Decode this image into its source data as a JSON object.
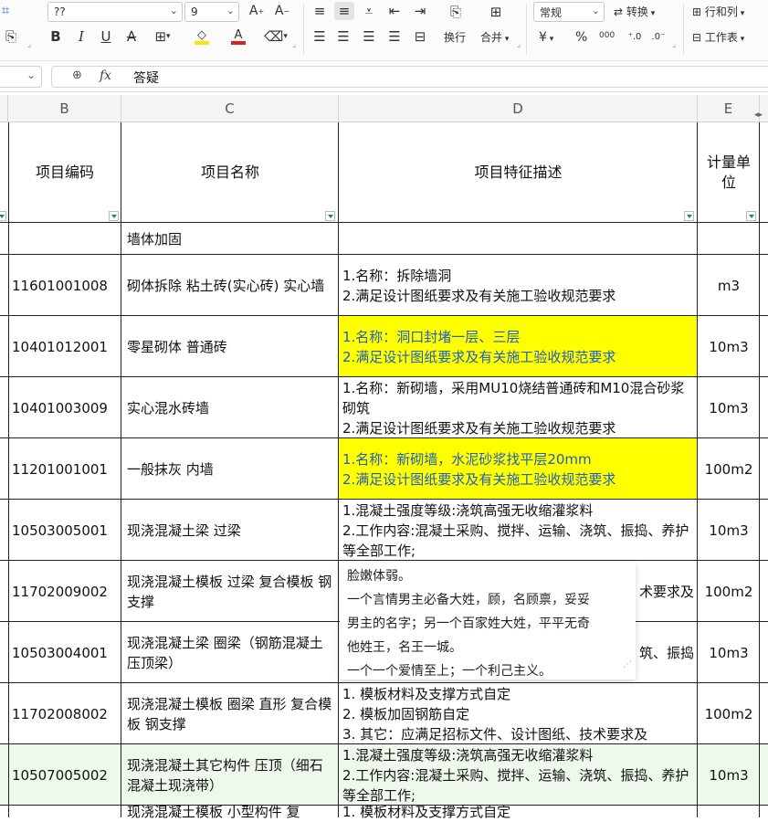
{
  "ribbon": {
    "font_name": "??",
    "font_size": "9",
    "number_format": "常规",
    "convert_label": "转换",
    "wrap_label": "换行",
    "merge_label": "合并",
    "rowcol_label": "行和列",
    "sheet_label": "工作表",
    "currency_glyph": "¥",
    "percent_glyph": "%",
    "thousands_glyph": "000",
    "font_color": "#e02020",
    "highlight_color": "#ffe600"
  },
  "formula_bar": {
    "fx_label": "fx",
    "content": "答疑"
  },
  "columns": [
    "B",
    "C",
    "D",
    "E"
  ],
  "header": {
    "code": "项目编码",
    "name": "项目名称",
    "desc": "项目特征描述",
    "unit": "计量单位"
  },
  "rows": [
    {
      "code": "",
      "name": "墙体加固",
      "desc": [],
      "unit": ""
    },
    {
      "code": "11601001008",
      "name": "砌体拆除 粘土砖(实心砖) 实心墙",
      "desc": [
        "1.名称：拆除墙洞",
        "2.满足设计图纸要求及有关施工验收规范要求"
      ],
      "unit": "m3"
    },
    {
      "code": "10401012001",
      "name": "零星砌体 普通砖",
      "desc": [
        "1.名称：洞口封堵一层、三层",
        "2.满足设计图纸要求及有关施工验收规范要求"
      ],
      "unit": "10m3"
    },
    {
      "code": "10401003009",
      "name": "实心混水砖墙",
      "desc": [
        "1.名称：新砌墙，采用MU10烧结普通砖和M10混合砂浆砌筑",
        "2.满足设计图纸要求及有关施工验收规范要求"
      ],
      "unit": "10m3"
    },
    {
      "code": "11201001001",
      "name": "一般抹灰 内墙",
      "desc": [
        "1.名称：新砌墙，水泥砂浆找平层20mm",
        "2.满足设计图纸要求及有关施工验收规范要求"
      ],
      "unit": "100m2"
    },
    {
      "code": "10503005001",
      "name": "现浇混凝土梁 过梁",
      "desc": [
        "1.混凝土强度等级:浇筑高强无收缩灌浆料",
        "2.工作内容:混凝土采购、搅拌、运输、浇筑、振捣、养护等全部工作;"
      ],
      "unit": "10m3"
    },
    {
      "code": "11702009002",
      "name": "现浇混凝土模板 过梁 复合模板 钢支撑",
      "desc": [
        "术要求及"
      ],
      "unit": "100m2"
    },
    {
      "code": "10503004001",
      "name": "现浇混凝土梁 圈梁（钢筋混凝土压顶梁）",
      "desc": [
        "筑、振捣"
      ],
      "unit": "10m3"
    },
    {
      "code": "11702008002",
      "name": "现浇混凝土模板 圈梁 直形 复合模板 钢支撑",
      "desc": [
        "1.  模板材料及支撑方式自定",
        "2.  模板加固钢筋自定",
        "3.  其它：应满足招标文件、设计图纸、技术要求及"
      ],
      "unit": "100m2"
    },
    {
      "code": "10507005002",
      "name": "现浇混凝土其它构件 压顶（细石混凝土现浇带）",
      "desc": [
        "1.混凝土强度等级:浇筑高强无收缩灌浆料",
        "2.工作内容:混凝土采购、搅拌、运输、浇筑、振捣、养护等全部工作;"
      ],
      "unit": "10m3"
    },
    {
      "code": "",
      "name": "现浇混凝土模板 小型构件 复",
      "desc": [
        "1.  模板材料及支撑方式自定"
      ],
      "unit": ""
    }
  ],
  "popup": {
    "lines": [
      "脸嫩体弱。",
      "一个言情男主必备大姓，顾，名顾禀，妥妥",
      "男主的名字；另一个百家姓大姓，平平无奇",
      "他姓王，名王一城。",
      "一个一个爱情至上；一个利己主义。"
    ]
  }
}
